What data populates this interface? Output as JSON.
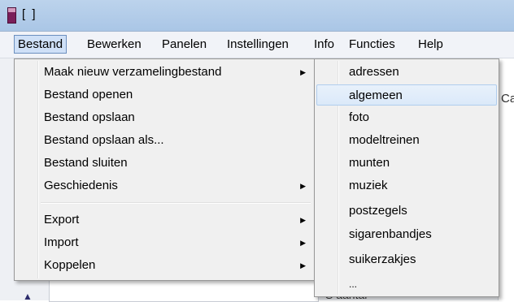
{
  "window": {
    "title": "[ ]"
  },
  "menubar": {
    "items": [
      {
        "label": "Bestand"
      },
      {
        "label": "Bewerken"
      },
      {
        "label": "Panelen"
      },
      {
        "label": "Instellingen"
      },
      {
        "label": "Info"
      },
      {
        "label": "Functies"
      },
      {
        "label": "Help"
      }
    ]
  },
  "bestand_menu": {
    "items": [
      {
        "label": "Maak nieuw verzamelingbestand",
        "submenu": true
      },
      {
        "label": "Bestand openen"
      },
      {
        "label": "Bestand opslaan"
      },
      {
        "label": "Bestand opslaan als..."
      },
      {
        "label": "Bestand sluiten"
      },
      {
        "label": "Geschiedenis",
        "submenu": true
      },
      {
        "label": "Export",
        "submenu": true
      },
      {
        "label": "Import",
        "submenu": true
      },
      {
        "label": "Koppelen",
        "submenu": true
      }
    ]
  },
  "submenu": {
    "items": [
      {
        "label": "adressen"
      },
      {
        "label": "algemeen",
        "highlighted": true
      },
      {
        "label": "foto"
      },
      {
        "label": "modeltreinen"
      },
      {
        "label": "munten"
      },
      {
        "label": "muziek"
      },
      {
        "label": "postzegels"
      },
      {
        "label": "sigarenbandjes"
      },
      {
        "label": "suikerzakjes"
      },
      {
        "label": "..."
      }
    ]
  },
  "background": {
    "partial_column_text": "Ca",
    "footer_text": "S aantal"
  }
}
